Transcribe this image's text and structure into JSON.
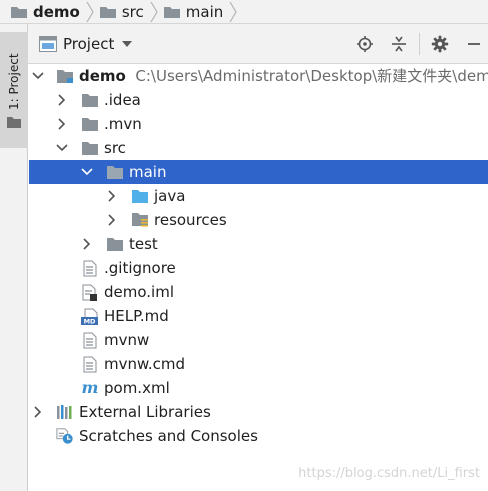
{
  "breadcrumb": [
    {
      "label": "demo",
      "icon": "folder-icon",
      "bold": true
    },
    {
      "label": "src",
      "icon": "folder-icon",
      "bold": false
    },
    {
      "label": "main",
      "icon": "folder-icon",
      "bold": false
    }
  ],
  "side_tab": {
    "label": "1: Project",
    "icon": "folder-icon"
  },
  "panel": {
    "title": "Project",
    "actions": [
      "locate-icon",
      "collapse-icon",
      "gear-icon",
      "minimize-icon"
    ]
  },
  "tree": {
    "selected": "main",
    "rows": [
      {
        "name": "demo",
        "path": "C:\\Users\\Administrator\\Desktop\\新建文件夹\\demo",
        "icon": "module-folder-icon",
        "arrow": "expanded",
        "bold": true
      },
      {
        "name": ".idea",
        "icon": "folder-icon",
        "arrow": "collapsed"
      },
      {
        "name": ".mvn",
        "icon": "folder-icon",
        "arrow": "collapsed"
      },
      {
        "name": "src",
        "icon": "folder-icon",
        "arrow": "expanded"
      },
      {
        "name": "main",
        "icon": "folder-icon",
        "arrow": "expanded"
      },
      {
        "name": "java",
        "icon": "source-folder-icon",
        "arrow": "collapsed"
      },
      {
        "name": "resources",
        "icon": "resources-folder-icon",
        "arrow": "collapsed"
      },
      {
        "name": "test",
        "icon": "folder-icon",
        "arrow": "collapsed"
      },
      {
        "name": ".gitignore",
        "icon": "text-file-icon",
        "arrow": "none"
      },
      {
        "name": "demo.iml",
        "icon": "iml-file-icon",
        "arrow": "none"
      },
      {
        "name": "HELP.md",
        "icon": "markdown-file-icon",
        "arrow": "none"
      },
      {
        "name": "mvnw",
        "icon": "text-file-icon",
        "arrow": "none"
      },
      {
        "name": "mvnw.cmd",
        "icon": "text-file-icon",
        "arrow": "none"
      },
      {
        "name": "pom.xml",
        "icon": "maven-icon",
        "arrow": "none"
      },
      {
        "name": "External Libraries",
        "icon": "libraries-icon",
        "arrow": "collapsed"
      },
      {
        "name": "Scratches and Consoles",
        "icon": "scratches-icon",
        "arrow": "none"
      }
    ]
  },
  "watermark": "https://blog.csdn.net/Li_first",
  "colors": {
    "selection": "#2f65ca",
    "folder": "#8a9299",
    "source_folder": "#52b0e8",
    "maven": "#3c8fcf"
  }
}
